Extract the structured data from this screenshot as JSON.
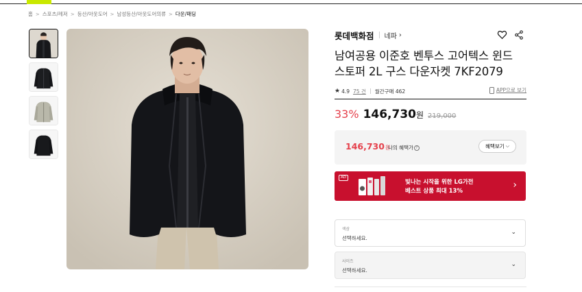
{
  "breadcrumb": {
    "items": [
      "홈",
      "스포츠/레저",
      "등산/아웃도어",
      "남성등산/아웃도어의류",
      "다운/패딩"
    ]
  },
  "product": {
    "brand": "롯데백화점",
    "seller": "네파",
    "title_line1": "남여공용 이준호 벤투스 고어텍스 윈드",
    "title_line2": "스토퍼 2L 구스 다운자켓 7KF2079",
    "rating": "4.9",
    "review_count": "75 건",
    "monthly_sales": "월간구매 462",
    "app_link": "APP으로 보기"
  },
  "pricing": {
    "discount": "33%",
    "price": "146,730",
    "won": "원",
    "original": "219,000",
    "benefit_price": "146,730",
    "benefit_won": "원",
    "benefit_label": "나의 혜택가",
    "benefit_button": "혜택보기"
  },
  "ad": {
    "badge": "AD",
    "line1": "빛나는 시작을 위한 LG가전",
    "line2": "베스트 상품 최대 13%",
    "color": "#c8102e"
  },
  "options": {
    "color_label": "색상",
    "color_placeholder": "선택하세요.",
    "size_label": "사이즈",
    "size_placeholder": "선택하세요."
  },
  "icons": {
    "wishlist": "heart-icon",
    "share": "share-icon",
    "star": "star-icon",
    "phone": "phone-icon"
  },
  "colors": {
    "accent": "#c9e800",
    "discount_red": "#e5404b"
  }
}
